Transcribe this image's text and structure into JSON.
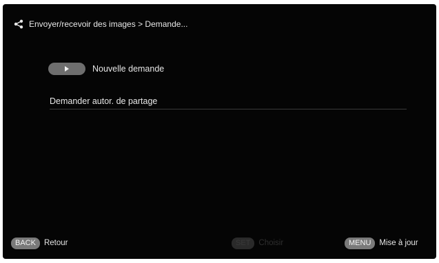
{
  "header": {
    "breadcrumb": "Envoyer/recevoir des images > Demande..."
  },
  "menu": {
    "new_request_label": "Nouvelle demande",
    "share_auth_label": "Demander autor. de partage"
  },
  "footer": {
    "back_key": "BACK",
    "back_label": "Retour",
    "set_key": "SET",
    "set_label": "Choisir",
    "menu_key": "MENU",
    "menu_label": "Mise à jour"
  },
  "icons": {
    "header": "share-icon",
    "new_request": "play-icon"
  },
  "colors": {
    "background": "#050505",
    "pill": "#7a7a7a",
    "text": "#e6e6e6"
  }
}
